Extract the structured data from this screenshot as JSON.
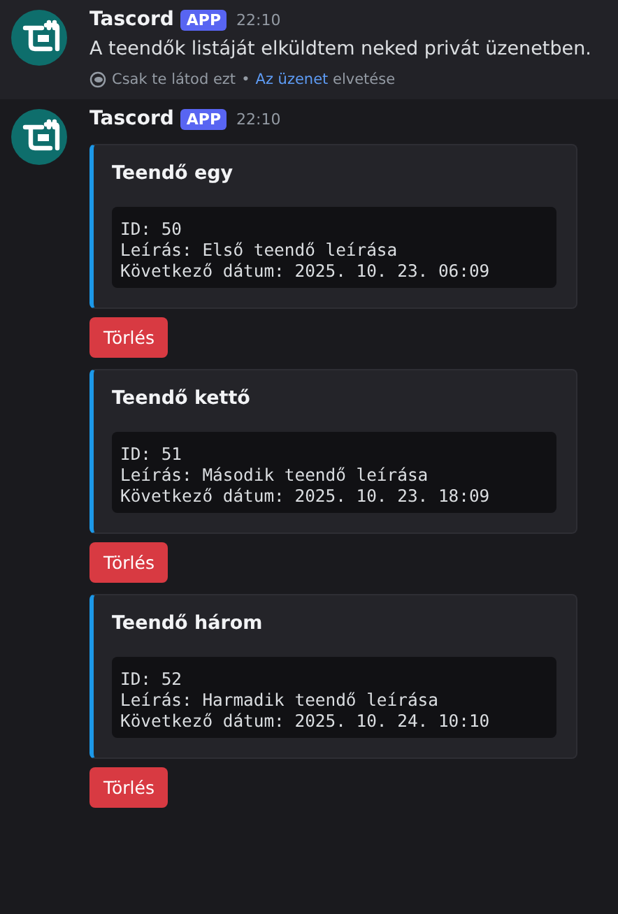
{
  "messages": [
    {
      "author": "Tascord",
      "badge": "APP",
      "time": "22:10",
      "text": "A teendők listáját elküldtem neked privát üzenetben.",
      "ephemeral": {
        "note": "Csak te látod ezt",
        "separator": "•",
        "link": "Az üzenet",
        "after": "elvetése"
      }
    },
    {
      "author": "Tascord",
      "badge": "APP",
      "time": "22:10",
      "embeds": [
        {
          "title": "Teendő egy",
          "lines": [
            "ID: 50",
            "Leírás: Első teendő leírása",
            "Következő dátum: 2025. 10. 23. 06:09"
          ],
          "button": "Törlés"
        },
        {
          "title": "Teendő kettő",
          "lines": [
            "ID: 51",
            "Leírás: Második teendő leírása",
            "Következő dátum: 2025. 10. 23. 18:09"
          ],
          "button": "Törlés"
        },
        {
          "title": "Teendő három",
          "lines": [
            "ID: 52",
            "Leírás: Harmadik teendő leírása",
            "Következő dátum: 2025. 10. 24. 10:10"
          ],
          "button": "Törlés"
        }
      ]
    }
  ]
}
